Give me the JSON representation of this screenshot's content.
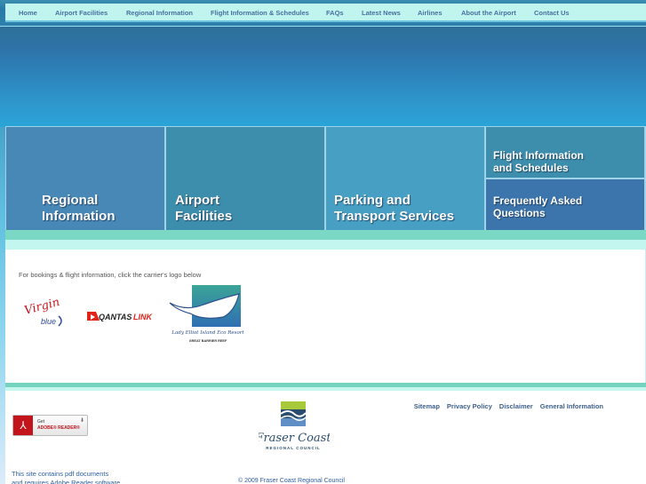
{
  "nav": {
    "items": [
      {
        "label": "Home"
      },
      {
        "label": "Airport Facilities"
      },
      {
        "label": "Regional Information"
      },
      {
        "label": "Flight Information & Schedules"
      },
      {
        "label": "FAQs"
      },
      {
        "label": "Latest News"
      },
      {
        "label": "Airlines"
      },
      {
        "label": "About the Airport"
      },
      {
        "label": "Contact Us"
      }
    ]
  },
  "tiles": {
    "regional": "Regional\nInformation",
    "facilities": "Airport\nFacilities",
    "parking": "Parking and\nTransport Services",
    "flight": "Flight Information\nand Schedules",
    "faq": "Frequently Asked\nQuestions"
  },
  "content": {
    "intro": "For bookings & flight information, click the carrier's logo below",
    "logos": {
      "virgin": "Virgin blue",
      "qantas": "QANTASLINK",
      "lady_elliot_line1": "Lady Elliot Island Eco Resort",
      "lady_elliot_line2": "GREAT BARRIER REEF"
    }
  },
  "footer": {
    "links": [
      {
        "label": "Sitemap"
      },
      {
        "label": "Privacy Policy"
      },
      {
        "label": "Disclaimer"
      },
      {
        "label": "General Information"
      }
    ],
    "adobe": {
      "get": "Get",
      "reader": "ADOBE® READER®"
    },
    "pdf_note_line1": "This site contains pdf documents",
    "pdf_note_line2": "and requires Adobe Reader software",
    "council_name": "Fraser Coast",
    "council_sub": "REGIONAL COUNCIL",
    "copyright": "© 2009 Fraser Coast Regional Council"
  },
  "colors": {
    "nav_bg": "#bff5ee",
    "nav_text": "#4a6f9e",
    "tile_regional": "#4888b7",
    "tile_facilities": "#3d8eac",
    "tile_parking": "#47a0c4",
    "tile_flight": "#3d8eac",
    "tile_faq": "#3c75ab",
    "band_green": "#7bd8c4"
  }
}
